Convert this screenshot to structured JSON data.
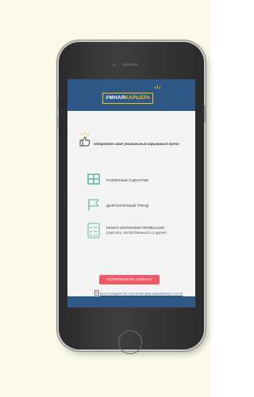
{
  "app": {
    "logo_part1": "УМНАЯ",
    "logo_part2": "КАРЬЕРА",
    "tagline": "Откройте свой уникальный карьерный путь!",
    "features": [
      {
        "icon": "scenarios-icon",
        "title": "РАЗЛИЧНЫЕ СЦЕНАРИИ",
        "subtitle": ""
      },
      {
        "icon": "flag-icon",
        "title": "ДОЛГОСРОЧНЫЙ ТРЕНД",
        "subtitle": ""
      },
      {
        "icon": "checklist-icon",
        "title": "МНОГО КРИТЕРИЕВ ПРОФЕССИЙ",
        "subtitle": "(зарплата, востребованность и другие)"
      }
    ],
    "cta_label": "ПОПРОБОВАТЬ СЕЙЧАС!",
    "guide_link": "ИНСТРУКЦИЯ ПО ПОСТРОЕНИЮ КАРЬЕРНОГО ПУТИ"
  },
  "colors": {
    "brand_blue": "#2f5886",
    "brand_yellow": "#f2c21b",
    "cta_red": "#ee5a66",
    "icon_green": "#7ac4a6",
    "page_bg": "#fcfbea"
  }
}
